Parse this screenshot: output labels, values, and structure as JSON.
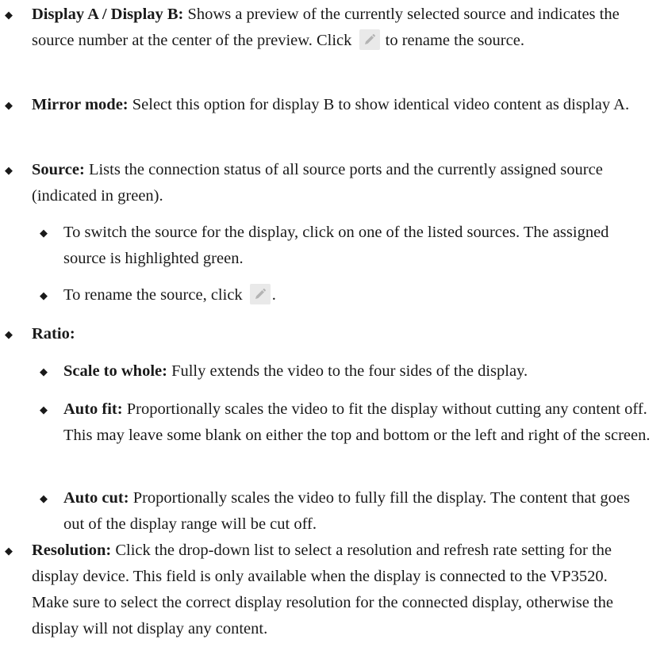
{
  "bullet_glyph": "◆",
  "items": [
    {
      "term": "Display A / Display B:",
      "text_a": " Shows a preview of the currently selected source and indicates the source number at the center of the preview. Click ",
      "text_b": " to rename the source."
    },
    {
      "term": "Mirror mode:",
      "text": " Select this option for display B to show identical video content as display A."
    },
    {
      "term": "Source:",
      "text": " Lists the connection status of all source ports and the currently assigned source (indicated in green).",
      "sub": [
        {
          "text": "To switch the source for the display, click on one of the listed sources. The assigned source is highlighted green."
        },
        {
          "text_a": "To rename the source, click ",
          "text_b": "."
        }
      ]
    },
    {
      "term": "Ratio:",
      "sub": [
        {
          "term": "Scale to whole:",
          "text": " Fully extends the video to the four sides of the display."
        },
        {
          "term": "Auto fit:",
          "text": " Proportionally scales the video to fit the display without cutting any content off. This may leave some blank on either the top and bottom or the left and right of the screen."
        },
        {
          "term": "Auto cut:",
          "text": " Proportionally scales the video to fully fill the display. The content that goes out of the display range will be cut off."
        }
      ]
    },
    {
      "term": "Resolution:",
      "text": " Click the drop-down list to select a resolution and refresh rate setting for the display device. This field is only available when the display is connected to the VP3520. Make sure to select the correct display resolution for the connected display, otherwise the display will not display any content."
    }
  ],
  "icons": {
    "rename": "pencil-icon"
  },
  "colors": {
    "text": "#1a1a1a",
    "icon_bg": "#e9e9e9",
    "icon_fg": "#b3b3b3"
  }
}
